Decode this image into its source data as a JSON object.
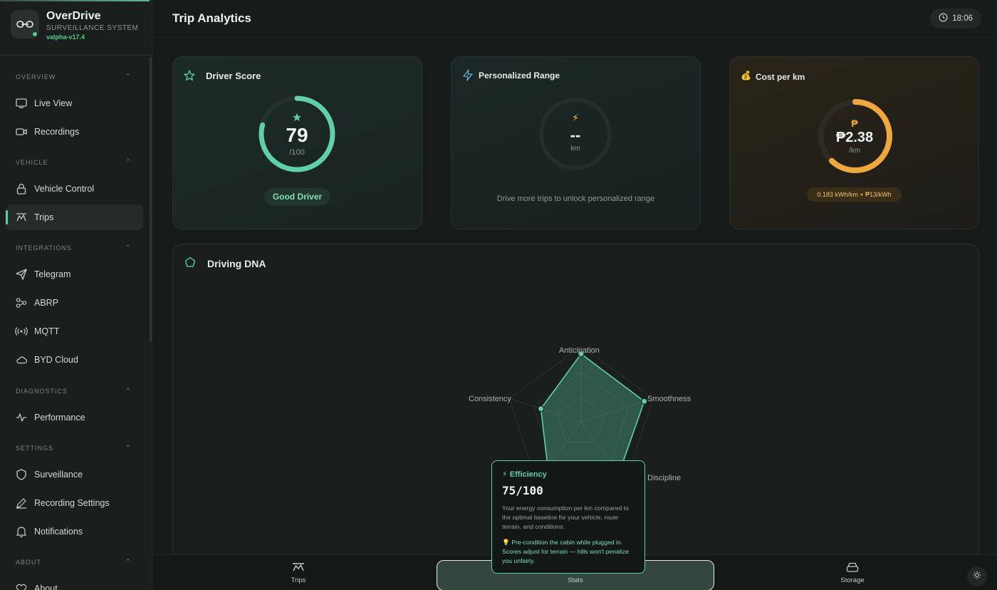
{
  "brand": {
    "title": "OverDrive",
    "subtitle": "SURVEILLANCE SYSTEM",
    "version": "valpha-v17.4"
  },
  "sidebar": {
    "sections": [
      {
        "title": "OVERVIEW",
        "items": [
          {
            "label": "Live View",
            "icon": "monitor-icon"
          },
          {
            "label": "Recordings",
            "icon": "video-camera-icon"
          }
        ]
      },
      {
        "title": "VEHICLE",
        "items": [
          {
            "label": "Vehicle Control",
            "icon": "lock-icon"
          },
          {
            "label": "Trips",
            "icon": "route-icon",
            "active": true
          }
        ]
      },
      {
        "title": "INTEGRATIONS",
        "items": [
          {
            "label": "Telegram",
            "icon": "send-icon"
          },
          {
            "label": "ABRP",
            "icon": "share-nodes-icon"
          },
          {
            "label": "MQTT",
            "icon": "broadcast-icon"
          },
          {
            "label": "BYD Cloud",
            "icon": "cloud-icon"
          }
        ]
      },
      {
        "title": "DIAGNOSTICS",
        "items": [
          {
            "label": "Performance",
            "icon": "pulse-icon"
          }
        ]
      },
      {
        "title": "SETTINGS",
        "items": [
          {
            "label": "Surveillance",
            "icon": "shield-icon"
          },
          {
            "label": "Recording Settings",
            "icon": "pen-icon"
          },
          {
            "label": "Notifications",
            "icon": "bell-icon"
          }
        ]
      },
      {
        "title": "ABOUT",
        "items": [
          {
            "label": "About",
            "icon": "heart-icon"
          }
        ]
      }
    ]
  },
  "header": {
    "title": "Trip Analytics",
    "time": "18:06"
  },
  "driver_score": {
    "title": "Driver Score",
    "score": "79",
    "max": "/100",
    "score_fraction": 0.79,
    "badge": "Good Driver"
  },
  "range": {
    "title": "Personalized Range",
    "value": "--",
    "unit": "km",
    "message": "Drive more trips to unlock personalized range"
  },
  "cost": {
    "title": "Cost per  km",
    "currency_symbol": "₱",
    "value": "₱2.38",
    "unit": "/km",
    "note": "0.183 kWh/km × ₱13/kWh",
    "ring_fraction": 0.62
  },
  "dna": {
    "title": "Driving DNA",
    "axes": [
      {
        "label": "Anticipation",
        "score": 90
      },
      {
        "label": "Smoothness",
        "score": 88
      },
      {
        "label": "Discipline",
        "score": 85
      },
      {
        "label": "Efficiency",
        "score": 75
      },
      {
        "label": "Consistency",
        "score": 56
      }
    ],
    "tooltip": {
      "title": "⚡ Efficiency",
      "score": "75/100",
      "description": "Your energy consumption per km compared to the optimal baseline for your vehicle, route terrain, and conditions.",
      "tip": "💡 Pre-condition the cabin while plugged in. Scores adjust for terrain — hills won't penalize you unfairly."
    }
  },
  "bottom_nav": {
    "trips": "Trips",
    "stats": "Stats",
    "storage": "Storage"
  },
  "colors": {
    "accent": "#5fd0a8",
    "amber": "#f0a83c",
    "good": "#4ecf8e"
  }
}
